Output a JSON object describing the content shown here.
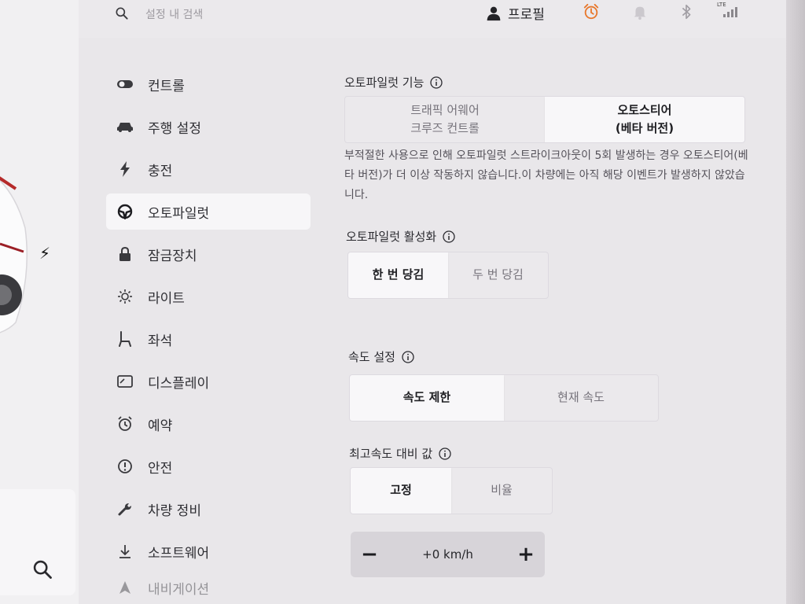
{
  "topbar": {
    "search_placeholder": "설정 내 검색",
    "profile_label": "프로필",
    "icons": [
      "search-icon",
      "person-icon",
      "alarm-clock-icon",
      "bell-icon",
      "bluetooth-icon",
      "lte-signal-icon"
    ],
    "lte_label": "LTE"
  },
  "car_panel": {
    "icons": [
      "charging-bolt-icon",
      "search-icon"
    ]
  },
  "nav": {
    "items": [
      {
        "label": "컨트롤",
        "icon": "toggle-icon"
      },
      {
        "label": "주행 설정",
        "icon": "car-icon"
      },
      {
        "label": "충전",
        "icon": "bolt-icon"
      },
      {
        "label": "오토파일럿",
        "icon": "steering-wheel-icon",
        "active": true
      },
      {
        "label": "잠금장치",
        "icon": "lock-icon"
      },
      {
        "label": "라이트",
        "icon": "light-icon"
      },
      {
        "label": "좌석",
        "icon": "seat-icon"
      },
      {
        "label": "디스플레이",
        "icon": "display-icon"
      },
      {
        "label": "예약",
        "icon": "schedule-clock-icon"
      },
      {
        "label": "안전",
        "icon": "safety-icon"
      },
      {
        "label": "차량 정비",
        "icon": "wrench-icon"
      },
      {
        "label": "소프트웨어",
        "icon": "download-icon"
      },
      {
        "label": "내비게이션",
        "icon": "navigation-icon"
      }
    ]
  },
  "autopilot_features": {
    "title": "오토파일럿 기능",
    "options": [
      {
        "label_line1": "트래픽 어웨어",
        "label_line2": "크루즈 컨트롤",
        "selected": false
      },
      {
        "label_line1": "오토스티어",
        "label_line2": "(베타 버전)",
        "selected": true
      }
    ],
    "note": "부적절한 사용으로 인해 오토파일럿 스트라이크아웃이 5회 발생하는 경우 오토스티어(베타 버전)가 더 이상 작동하지 않습니다.이 차량에는 아직 해당 이벤트가 발생하지 않았습니다."
  },
  "autopilot_activation": {
    "title": "오토파일럿 활성화",
    "options": [
      {
        "label": "한 번 당김",
        "selected": true
      },
      {
        "label": "두 번 당김",
        "selected": false
      }
    ]
  },
  "speed_setting": {
    "title": "속도 설정",
    "options": [
      {
        "label": "속도 제한",
        "selected": true
      },
      {
        "label": "현재 속도",
        "selected": false
      }
    ]
  },
  "speed_offset": {
    "title": "최고속도 대비 값",
    "options": [
      {
        "label": "고정",
        "selected": true
      },
      {
        "label": "비율",
        "selected": false
      }
    ],
    "minus": "−",
    "value": "+0 km/h",
    "plus": "+"
  },
  "colors": {
    "background": "#e9e7ea",
    "selected_segment": "#f8f7f9",
    "alarm_orange": "#e8782c"
  }
}
